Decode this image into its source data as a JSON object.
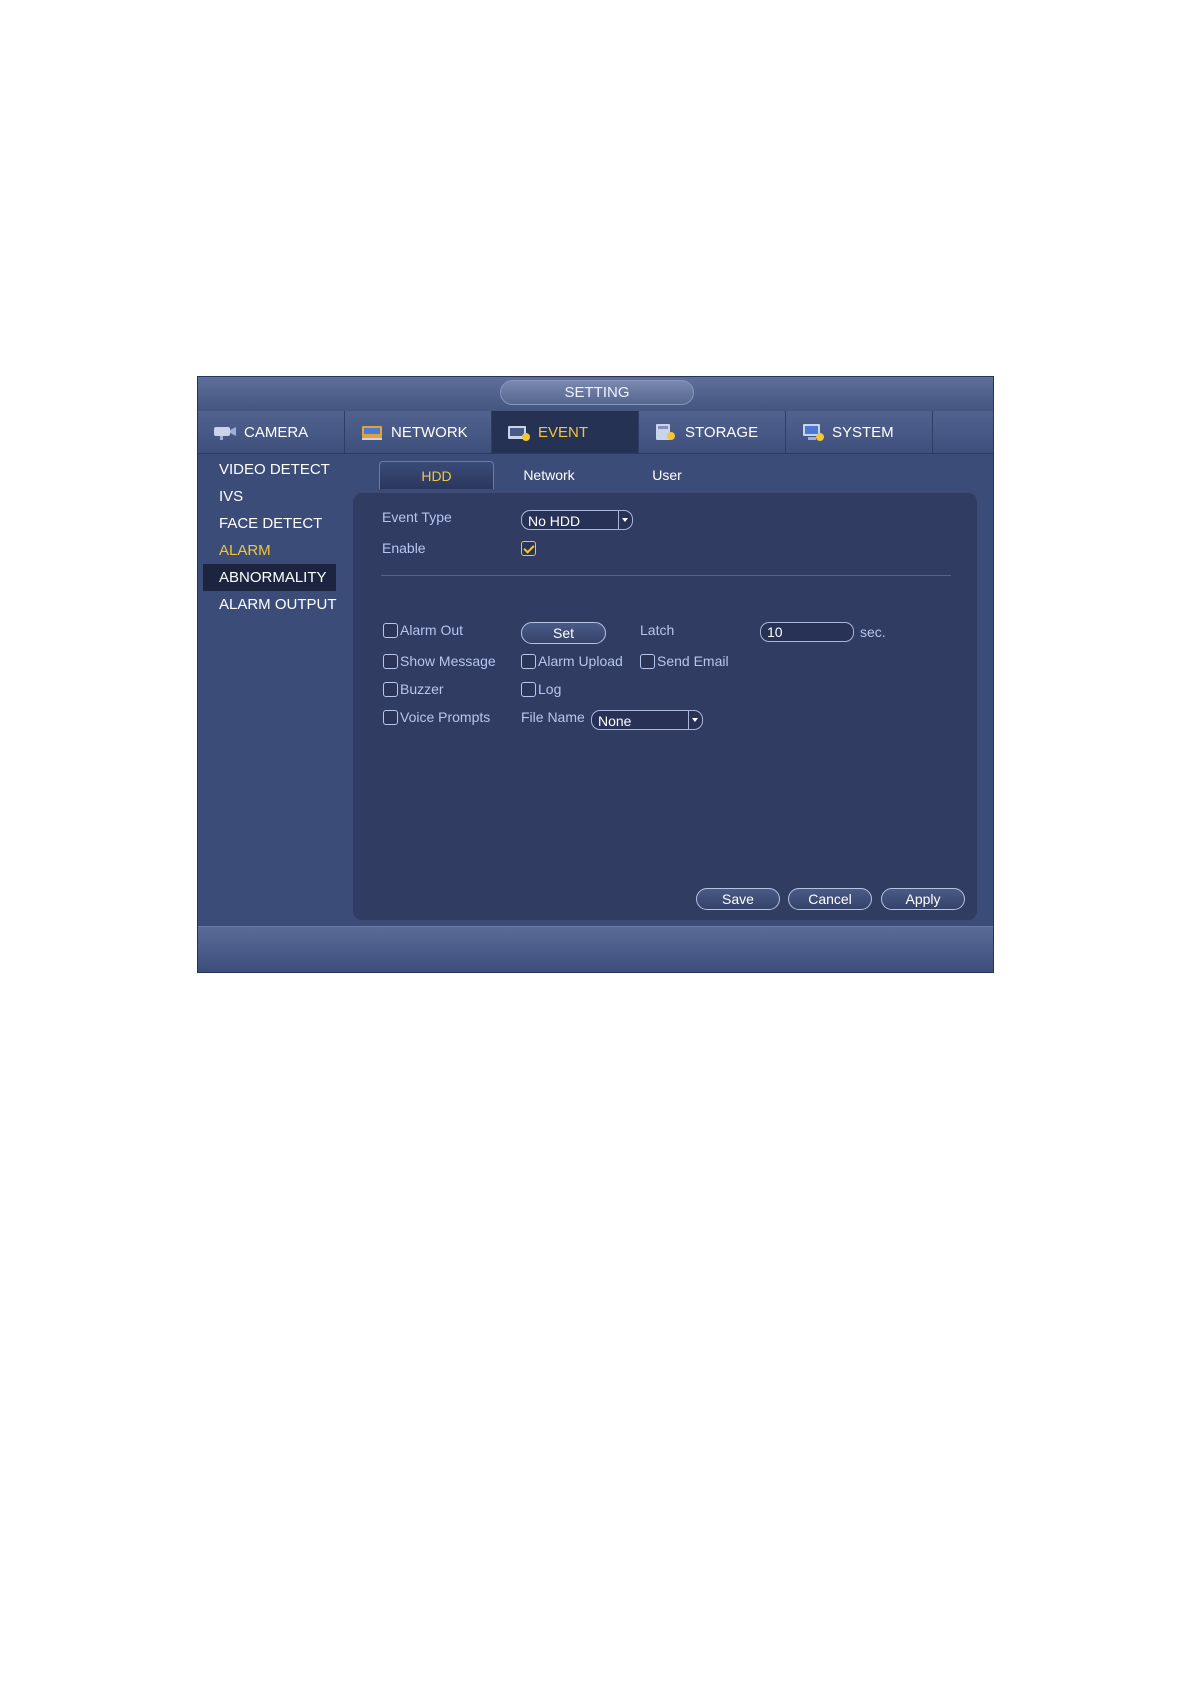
{
  "window": {
    "title": "SETTING"
  },
  "topnav": [
    {
      "label": "CAMERA",
      "icon": "camera-icon"
    },
    {
      "label": "NETWORK",
      "icon": "network-icon"
    },
    {
      "label": "EVENT",
      "icon": "event-icon"
    },
    {
      "label": "STORAGE",
      "icon": "storage-icon"
    },
    {
      "label": "SYSTEM",
      "icon": "system-icon"
    }
  ],
  "sidebar": {
    "items": [
      {
        "label": "VIDEO DETECT"
      },
      {
        "label": "IVS"
      },
      {
        "label": "FACE DETECT"
      },
      {
        "label": "ALARM"
      },
      {
        "label": "ABNORMALITY"
      },
      {
        "label": "ALARM OUTPUT"
      }
    ]
  },
  "subtabs": [
    {
      "label": "HDD"
    },
    {
      "label": "Network"
    },
    {
      "label": "User"
    }
  ],
  "form": {
    "event_type_label": "Event Type",
    "event_type_value": "No HDD",
    "enable_label": "Enable",
    "enable_checked": true,
    "alarm_out_label": "Alarm Out",
    "set_button": "Set",
    "latch_label": "Latch",
    "latch_value": "10",
    "latch_unit": "sec.",
    "show_message_label": "Show Message",
    "alarm_upload_label": "Alarm Upload",
    "send_email_label": "Send Email",
    "buzzer_label": "Buzzer",
    "log_label": "Log",
    "voice_prompts_label": "Voice Prompts",
    "file_name_label": "File Name",
    "file_name_value": "None"
  },
  "actions": {
    "save": "Save",
    "cancel": "Cancel",
    "apply": "Apply"
  },
  "colors": {
    "accent": "#f2c63a",
    "window_bg": "#3c4c78",
    "panel_bg": "#303c62",
    "label": "#b7c6ee"
  }
}
